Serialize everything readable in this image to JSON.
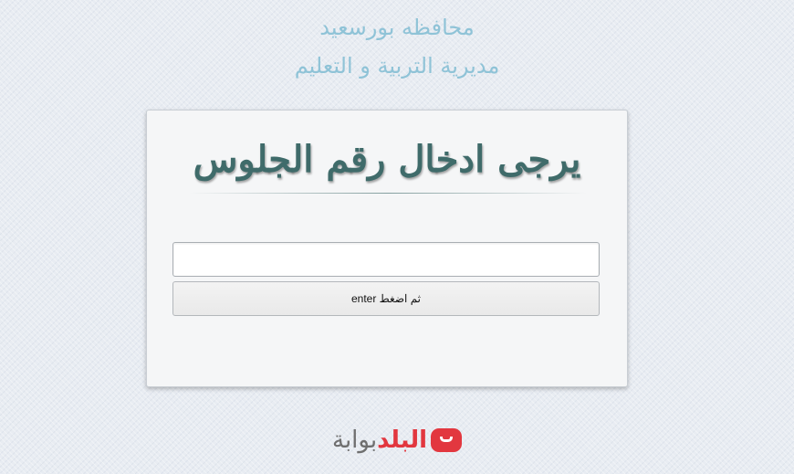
{
  "header": {
    "line1": "محافظه بورسعيد",
    "line2": "مديرية التربية و التعليم"
  },
  "form": {
    "title": "يرجى ادخال رقم الجلوس",
    "input_value": "",
    "submit_label": "ثم اضغط enter"
  },
  "footer": {
    "logo_text_gray": "بوابة",
    "logo_text_red": "البلد"
  },
  "colors": {
    "header_text": "#8fc3d7",
    "title_text": "#3f6b6a",
    "logo_red": "#e2373f",
    "logo_gray": "#6f6f6f"
  }
}
